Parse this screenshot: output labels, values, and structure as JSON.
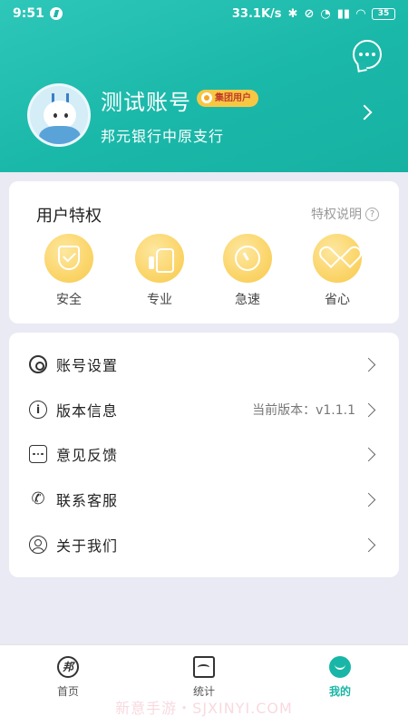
{
  "status_bar": {
    "time": "9:51",
    "network_speed": "33.1K/s",
    "battery": "35"
  },
  "header": {
    "user_name": "测试账号",
    "badge": "集团用户",
    "bank_name": "邦元银行中原支行"
  },
  "privileges": {
    "title": "用户特权",
    "help_label": "特权说明",
    "items": [
      {
        "label": "安全",
        "icon": "shield-check-icon"
      },
      {
        "label": "专业",
        "icon": "thumbs-up-icon"
      },
      {
        "label": "急速",
        "icon": "speed-dial-icon"
      },
      {
        "label": "省心",
        "icon": "heart-icon"
      }
    ]
  },
  "menu": {
    "items": [
      {
        "label": "账号设置",
        "icon": "gear-icon"
      },
      {
        "label": "版本信息",
        "icon": "info-icon",
        "value": "当前版本：v1.1.1"
      },
      {
        "label": "意见反馈",
        "icon": "chat-icon"
      },
      {
        "label": "联系客服",
        "icon": "phone-icon"
      },
      {
        "label": "关于我们",
        "icon": "user-icon"
      }
    ]
  },
  "tabbar": {
    "items": [
      {
        "label": "首页",
        "icon": "home-icon"
      },
      {
        "label": "统计",
        "icon": "stats-icon"
      },
      {
        "label": "我的",
        "icon": "mine-icon",
        "active": true
      }
    ]
  },
  "watermark": "新意手游・SJXINYI.COM",
  "colors": {
    "accent": "#18b6a6",
    "badge": "#f7c744",
    "privilege_icon": "#fbd56a"
  }
}
